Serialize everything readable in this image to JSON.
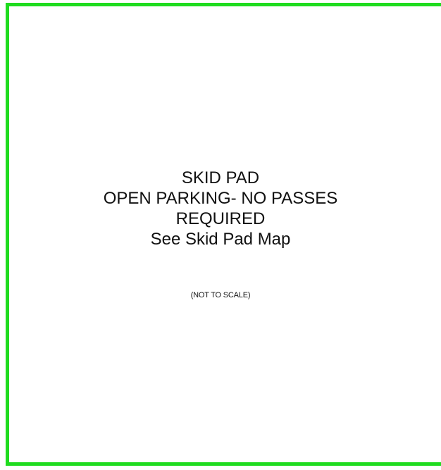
{
  "map": {
    "border_color": "#1fdc1f",
    "label_lines": [
      "SKID PAD",
      "OPEN PARKING- NO PASSES",
      "REQUIRED",
      "See Skid Pad Map"
    ],
    "scale_note": "(NOT TO SCALE)"
  }
}
